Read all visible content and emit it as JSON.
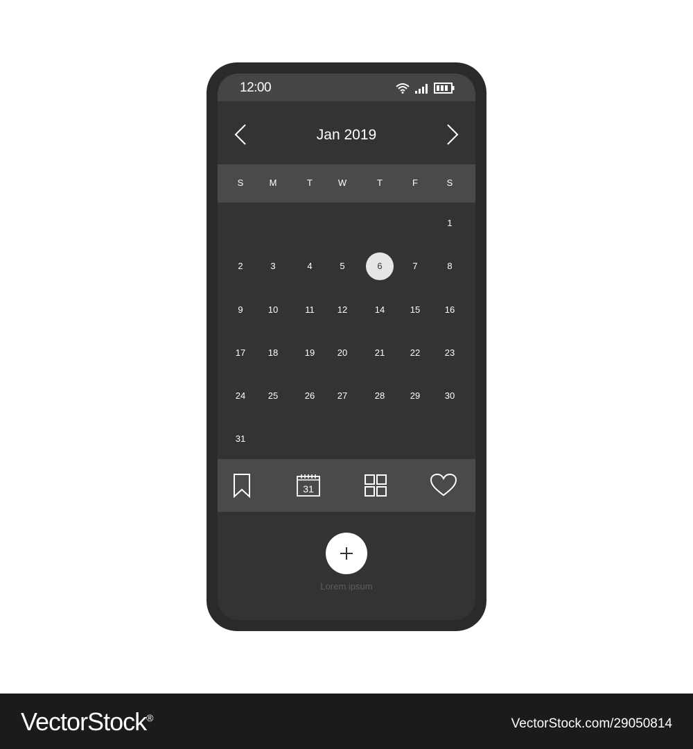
{
  "status_bar": {
    "time": "12:00",
    "icons": [
      "wifi-icon",
      "signal-icon",
      "battery-icon"
    ]
  },
  "calendar": {
    "month_title": "Jan 2019",
    "weekdays": [
      "S",
      "M",
      "T",
      "W",
      "T",
      "F",
      "S"
    ],
    "first_weekday_index": 6,
    "days": [
      "1",
      "2",
      "3",
      "4",
      "5",
      "6",
      "7",
      "8",
      "9",
      "10",
      "11",
      "12",
      "14",
      "15",
      "16",
      "17",
      "18",
      "19",
      "20",
      "21",
      "22",
      "23",
      "24",
      "25",
      "26",
      "27",
      "28",
      "29",
      "30",
      "31"
    ],
    "selected_day": "6"
  },
  "tab_bar": {
    "tabs": [
      {
        "icon": "bookmark-icon"
      },
      {
        "icon": "calendar-icon",
        "text": "31"
      },
      {
        "icon": "grid-icon"
      },
      {
        "icon": "heart-icon"
      }
    ]
  },
  "fab": {
    "icon": "plus-icon",
    "label": "Lorem ipsum"
  },
  "watermark": {
    "brand": "VectorStock",
    "registered_mark": "®",
    "image_id": "VectorStock.com/29050814"
  },
  "colors": {
    "phone_frame": "#2a2a2a",
    "screen_bg": "#333333",
    "bar_bg": "#4a4a4a",
    "selected_day_bg": "#e6e6e6",
    "fab_label": "#5e5e5e"
  }
}
